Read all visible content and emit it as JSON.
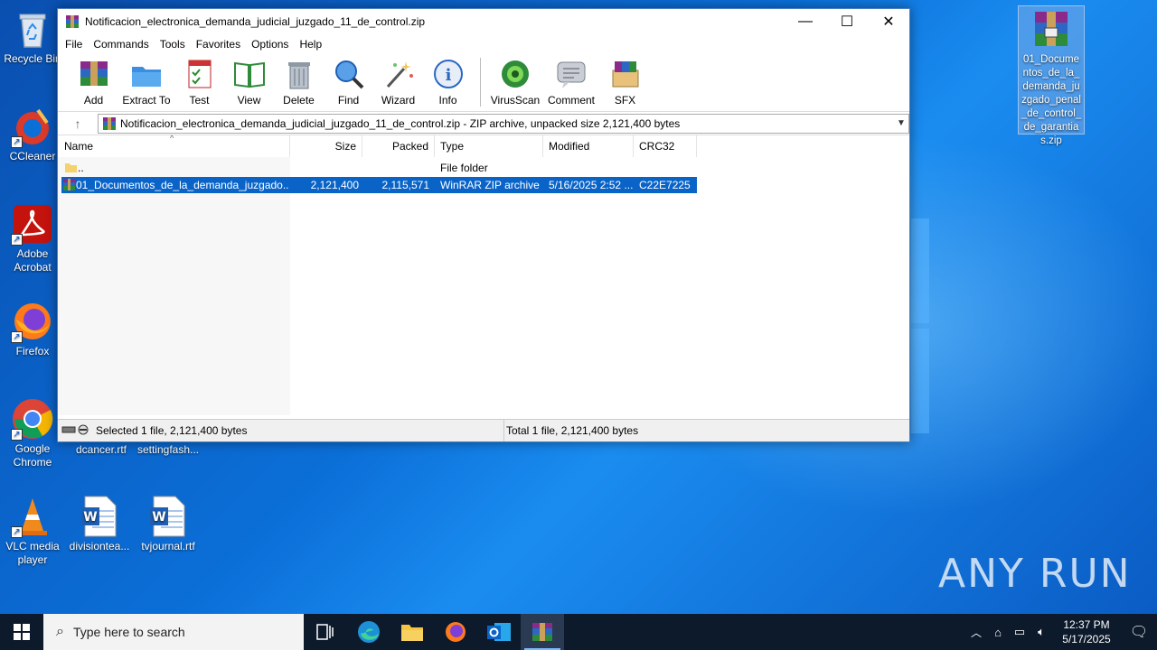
{
  "desktop": {
    "icons": [
      {
        "label": "Recycle Bin"
      },
      {
        "label": "CCleaner"
      },
      {
        "label": "Adobe Acrobat"
      },
      {
        "label": "Firefox"
      },
      {
        "label": "Google Chrome"
      },
      {
        "label": "dcancer.rtf"
      },
      {
        "label": "settingfash..."
      },
      {
        "label": "VLC media player"
      },
      {
        "label": "divisiontea..."
      },
      {
        "label": "tvjournal.rtf"
      },
      {
        "label": "01_Documentos_de_la_demanda_juzgado_penal_de_control_de_garantias.zip"
      }
    ],
    "watermark": "ANY RUN"
  },
  "window": {
    "title": "Notificacion_electronica_demanda_judicial_juzgado_11_de_control.zip",
    "controls": {
      "minimize": "—",
      "maximize": "☐",
      "close": "✕"
    },
    "menu": [
      "File",
      "Commands",
      "Tools",
      "Favorites",
      "Options",
      "Help"
    ],
    "toolbar": [
      "Add",
      "Extract To",
      "Test",
      "View",
      "Delete",
      "Find",
      "Wizard",
      "Info",
      "VirusScan",
      "Comment",
      "SFX"
    ],
    "address": "Notificacion_electronica_demanda_judicial_juzgado_11_de_control.zip - ZIP archive, unpacked size 2,121,400 bytes",
    "columns": [
      "Name",
      "Size",
      "Packed",
      "Type",
      "Modified",
      "CRC32"
    ],
    "rows": [
      {
        "name": "..",
        "size": "",
        "packed": "",
        "type": "File folder",
        "modified": "",
        "crc": ""
      },
      {
        "name": "01_Documentos_de_la_demanda_juzgado...",
        "size": "2,121,400",
        "packed": "2,115,571",
        "type": "WinRAR ZIP archive",
        "modified": "5/16/2025 2:52 ...",
        "crc": "C22E7225"
      }
    ],
    "status_left": "Selected 1 file, 2,121,400 bytes",
    "status_right": "Total 1 file, 2,121,400 bytes"
  },
  "taskbar": {
    "search_placeholder": "Type here to search",
    "time": "12:37 PM",
    "date": "5/17/2025"
  },
  "colors": {
    "selection": "#0a64c8",
    "desktop": "#0b6fd8",
    "taskbar": "#0d1a2b"
  }
}
